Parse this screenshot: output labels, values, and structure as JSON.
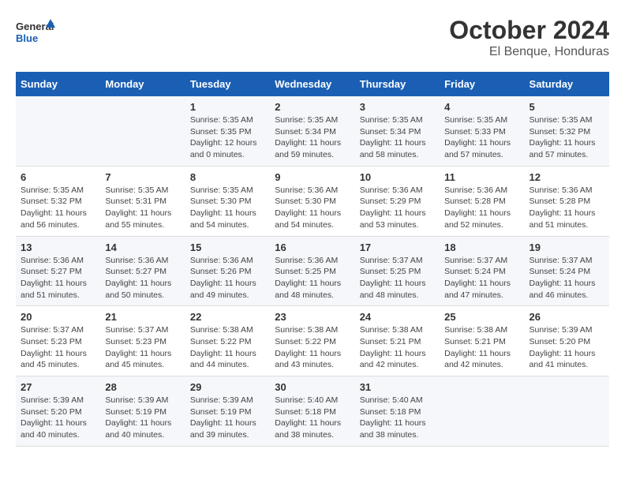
{
  "header": {
    "logo_general": "General",
    "logo_blue": "Blue",
    "title": "October 2024",
    "subtitle": "El Benque, Honduras"
  },
  "calendar": {
    "days_of_week": [
      "Sunday",
      "Monday",
      "Tuesday",
      "Wednesday",
      "Thursday",
      "Friday",
      "Saturday"
    ],
    "weeks": [
      [
        {
          "day": "",
          "info": ""
        },
        {
          "day": "",
          "info": ""
        },
        {
          "day": "1",
          "info": "Sunrise: 5:35 AM\nSunset: 5:35 PM\nDaylight: 12 hours\nand 0 minutes."
        },
        {
          "day": "2",
          "info": "Sunrise: 5:35 AM\nSunset: 5:34 PM\nDaylight: 11 hours\nand 59 minutes."
        },
        {
          "day": "3",
          "info": "Sunrise: 5:35 AM\nSunset: 5:34 PM\nDaylight: 11 hours\nand 58 minutes."
        },
        {
          "day": "4",
          "info": "Sunrise: 5:35 AM\nSunset: 5:33 PM\nDaylight: 11 hours\nand 57 minutes."
        },
        {
          "day": "5",
          "info": "Sunrise: 5:35 AM\nSunset: 5:32 PM\nDaylight: 11 hours\nand 57 minutes."
        }
      ],
      [
        {
          "day": "6",
          "info": "Sunrise: 5:35 AM\nSunset: 5:32 PM\nDaylight: 11 hours\nand 56 minutes."
        },
        {
          "day": "7",
          "info": "Sunrise: 5:35 AM\nSunset: 5:31 PM\nDaylight: 11 hours\nand 55 minutes."
        },
        {
          "day": "8",
          "info": "Sunrise: 5:35 AM\nSunset: 5:30 PM\nDaylight: 11 hours\nand 54 minutes."
        },
        {
          "day": "9",
          "info": "Sunrise: 5:36 AM\nSunset: 5:30 PM\nDaylight: 11 hours\nand 54 minutes."
        },
        {
          "day": "10",
          "info": "Sunrise: 5:36 AM\nSunset: 5:29 PM\nDaylight: 11 hours\nand 53 minutes."
        },
        {
          "day": "11",
          "info": "Sunrise: 5:36 AM\nSunset: 5:28 PM\nDaylight: 11 hours\nand 52 minutes."
        },
        {
          "day": "12",
          "info": "Sunrise: 5:36 AM\nSunset: 5:28 PM\nDaylight: 11 hours\nand 51 minutes."
        }
      ],
      [
        {
          "day": "13",
          "info": "Sunrise: 5:36 AM\nSunset: 5:27 PM\nDaylight: 11 hours\nand 51 minutes."
        },
        {
          "day": "14",
          "info": "Sunrise: 5:36 AM\nSunset: 5:27 PM\nDaylight: 11 hours\nand 50 minutes."
        },
        {
          "day": "15",
          "info": "Sunrise: 5:36 AM\nSunset: 5:26 PM\nDaylight: 11 hours\nand 49 minutes."
        },
        {
          "day": "16",
          "info": "Sunrise: 5:36 AM\nSunset: 5:25 PM\nDaylight: 11 hours\nand 48 minutes."
        },
        {
          "day": "17",
          "info": "Sunrise: 5:37 AM\nSunset: 5:25 PM\nDaylight: 11 hours\nand 48 minutes."
        },
        {
          "day": "18",
          "info": "Sunrise: 5:37 AM\nSunset: 5:24 PM\nDaylight: 11 hours\nand 47 minutes."
        },
        {
          "day": "19",
          "info": "Sunrise: 5:37 AM\nSunset: 5:24 PM\nDaylight: 11 hours\nand 46 minutes."
        }
      ],
      [
        {
          "day": "20",
          "info": "Sunrise: 5:37 AM\nSunset: 5:23 PM\nDaylight: 11 hours\nand 45 minutes."
        },
        {
          "day": "21",
          "info": "Sunrise: 5:37 AM\nSunset: 5:23 PM\nDaylight: 11 hours\nand 45 minutes."
        },
        {
          "day": "22",
          "info": "Sunrise: 5:38 AM\nSunset: 5:22 PM\nDaylight: 11 hours\nand 44 minutes."
        },
        {
          "day": "23",
          "info": "Sunrise: 5:38 AM\nSunset: 5:22 PM\nDaylight: 11 hours\nand 43 minutes."
        },
        {
          "day": "24",
          "info": "Sunrise: 5:38 AM\nSunset: 5:21 PM\nDaylight: 11 hours\nand 42 minutes."
        },
        {
          "day": "25",
          "info": "Sunrise: 5:38 AM\nSunset: 5:21 PM\nDaylight: 11 hours\nand 42 minutes."
        },
        {
          "day": "26",
          "info": "Sunrise: 5:39 AM\nSunset: 5:20 PM\nDaylight: 11 hours\nand 41 minutes."
        }
      ],
      [
        {
          "day": "27",
          "info": "Sunrise: 5:39 AM\nSunset: 5:20 PM\nDaylight: 11 hours\nand 40 minutes."
        },
        {
          "day": "28",
          "info": "Sunrise: 5:39 AM\nSunset: 5:19 PM\nDaylight: 11 hours\nand 40 minutes."
        },
        {
          "day": "29",
          "info": "Sunrise: 5:39 AM\nSunset: 5:19 PM\nDaylight: 11 hours\nand 39 minutes."
        },
        {
          "day": "30",
          "info": "Sunrise: 5:40 AM\nSunset: 5:18 PM\nDaylight: 11 hours\nand 38 minutes."
        },
        {
          "day": "31",
          "info": "Sunrise: 5:40 AM\nSunset: 5:18 PM\nDaylight: 11 hours\nand 38 minutes."
        },
        {
          "day": "",
          "info": ""
        },
        {
          "day": "",
          "info": ""
        }
      ]
    ]
  }
}
